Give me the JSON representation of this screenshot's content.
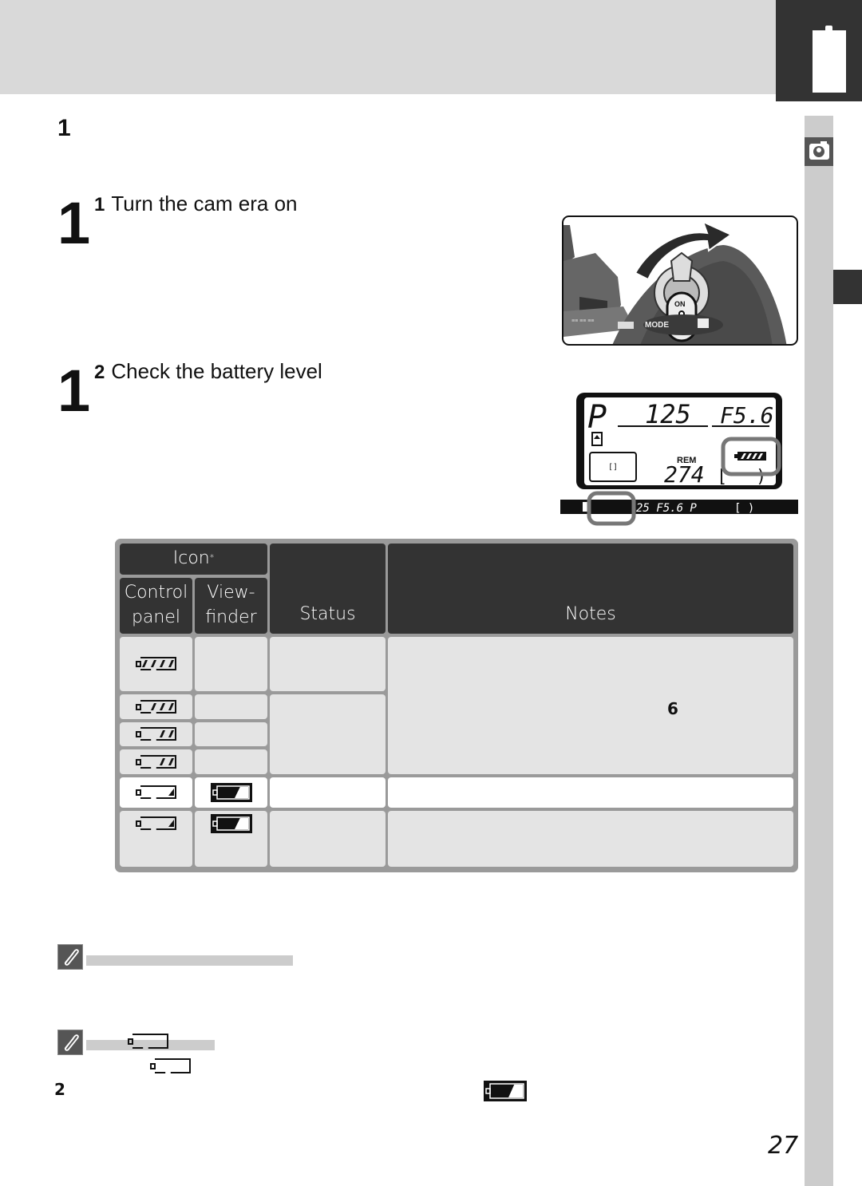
{
  "header": {
    "chapter_icon": "battery-chapter-icon",
    "side_icon": "camera-person-icon"
  },
  "section": {
    "number": "1"
  },
  "steps": [
    {
      "big_number": "1",
      "sub_number": "1",
      "title": "Turn the cam era on"
    },
    {
      "big_number": "1",
      "sub_number": "2",
      "title": "Check the battery level"
    }
  ],
  "figure_lcd": {
    "mode": "P",
    "shutter": "125",
    "aperture": "F5.6",
    "rem_label": "REM",
    "frames_remaining": "274",
    "viewfinder_readout": "25  F5.6 P"
  },
  "battery_table": {
    "headers": {
      "icon": "Icon",
      "icon_marker": "*",
      "control_panel": "Control panel",
      "control_panel_l1": "Control",
      "control_panel_l2": "panel",
      "viewfinder_l1": "View-",
      "viewfinder_l2": "finder",
      "status": "Status",
      "notes": "Notes"
    },
    "rows": [
      {
        "control_panel_icon": "battery-full-4-bars-icon",
        "bars": 4,
        "viewfinder_icon": "",
        "status": "",
        "notes": ""
      },
      {
        "control_panel_icon": "battery-3-bars-icon",
        "bars": 3,
        "viewfinder_icon": "",
        "status": "",
        "notes": "6"
      },
      {
        "control_panel_icon": "battery-2-bars-icon",
        "bars": 2,
        "viewfinder_icon": "",
        "status": "",
        "notes": ""
      },
      {
        "control_panel_icon": "battery-1-bar-icon",
        "bars": 1,
        "viewfinder_icon": "",
        "status": "",
        "notes": ""
      },
      {
        "control_panel_icon": "battery-low-icon",
        "bars": 1,
        "viewfinder_icon": "battery-low-viewfinder-icon",
        "status": "",
        "notes": ""
      },
      {
        "control_panel_icon": "battery-low-blinking-icon",
        "bars": 1,
        "viewfinder_icon": "battery-low-viewfinder-blinking-icon",
        "status": "",
        "notes": ""
      }
    ]
  },
  "notes": [
    {
      "icon": "paperclip-icon"
    },
    {
      "icon": "paperclip-icon"
    }
  ],
  "footnote": {
    "marker": "2"
  },
  "page_number": "27"
}
